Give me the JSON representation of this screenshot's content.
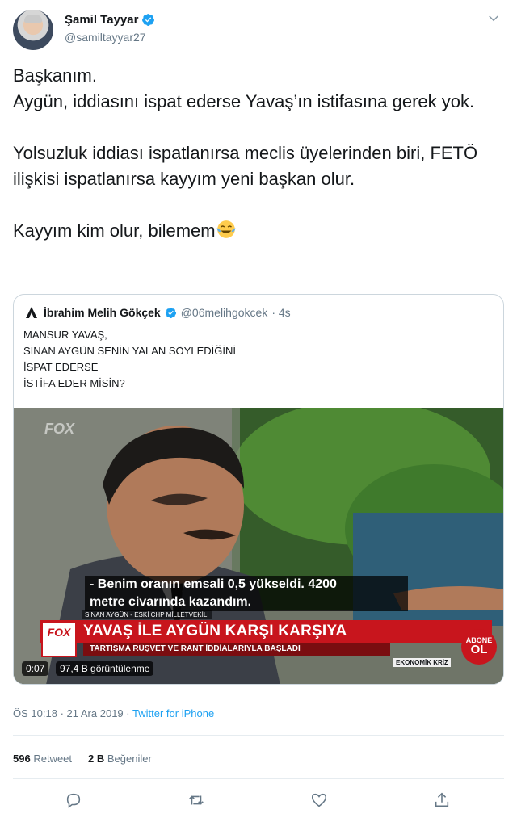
{
  "author": {
    "name": "Şamil Tayyar",
    "handle": "@samiltayyar27"
  },
  "tweet": {
    "text": "Başkanım.\nAygün, iddiasını ispat ederse Yavaş’ın istifasına gerek yok.\n\nYolsuzluk iddiası ispatlanırsa meclis üyelerinden biri, FETÖ ilişkisi ispatlanırsa kayyım yeni başkan olur.\n\nKayyım kim olur, bilemem",
    "emoji": "face-with-tears-of-joy-icon"
  },
  "quoted": {
    "name": "İbrahim Melih Gökçek",
    "handle": "@06melihgokcek",
    "time": "· 4s",
    "text": "MANSUR YAVAŞ,\nSİNAN AYGÜN SENİN YALAN SÖYLEDİĞİNİ\nİSPAT EDERSE\nİSTİFA EDER MİSİN?",
    "video": {
      "watermark": "FOX",
      "subtitle": "- Benim oranın emsali 0,5 yükseldi. 4200\nmetre civarında kazandım.",
      "lower_third_name": "SİNAN AYGÜN - ESKİ CHP MİLLETVEKİLİ",
      "channel_logo": "FOX",
      "banner_title": "YAVAŞ İLE AYGÜN KARŞI KARŞIYA",
      "banner_subtitle": "TARTIŞMA RÜŞVET VE RANT İDDİALARIYLA BAŞLADI",
      "ticker": "EKONOMİK KRİZ",
      "subscribe_top": "ABONE",
      "subscribe_bottom": "OL",
      "duration": "0:07",
      "views": "97,4 B görüntülenme"
    }
  },
  "meta": {
    "time": "ÖS 10:18",
    "date": "21 Ara 2019",
    "separator": "·",
    "source": "Twitter for iPhone"
  },
  "stats": {
    "retweets_count": "596",
    "retweets_label": "Retweet",
    "likes_count": "2 B",
    "likes_label": "Beğeniler"
  },
  "colors": {
    "accent": "#1da1f2",
    "text": "#14171a",
    "muted": "#657786",
    "border": "#ccd6dd",
    "fox_red": "#c8151d"
  }
}
